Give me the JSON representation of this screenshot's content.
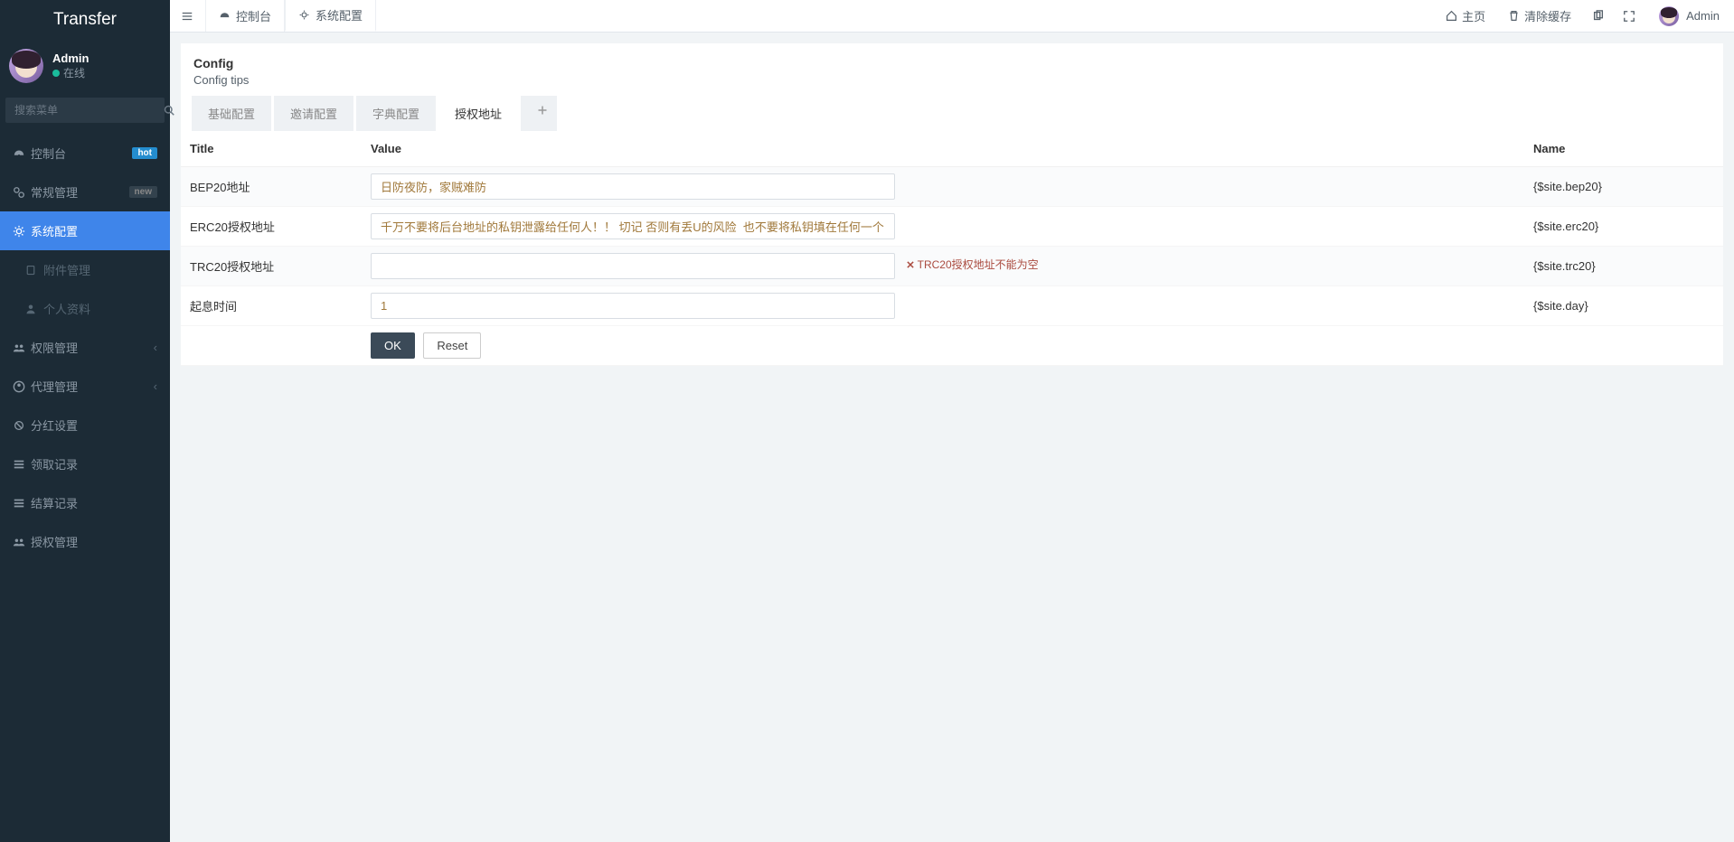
{
  "brand": "Transfer",
  "user": {
    "name": "Admin",
    "status": "在线"
  },
  "search": {
    "placeholder": "搜索菜单"
  },
  "sidebar": {
    "items": [
      {
        "label": "控制台",
        "badge": "hot"
      },
      {
        "label": "常规管理",
        "badge": "new"
      },
      {
        "label": "系统配置"
      },
      {
        "label": "附件管理"
      },
      {
        "label": "个人资料"
      },
      {
        "label": "权限管理"
      },
      {
        "label": "代理管理"
      },
      {
        "label": "分红设置"
      },
      {
        "label": "领取记录"
      },
      {
        "label": "结算记录"
      },
      {
        "label": "授权管理"
      }
    ]
  },
  "topbar": {
    "tabs": [
      {
        "label": "控制台"
      },
      {
        "label": "系统配置"
      }
    ],
    "home": "主页",
    "clear_cache": "清除缓存",
    "user": "Admin"
  },
  "panel": {
    "title": "Config",
    "subtitle": "Config tips"
  },
  "cfg_tabs": [
    {
      "label": "基础配置"
    },
    {
      "label": "邀请配置"
    },
    {
      "label": "字典配置"
    },
    {
      "label": "授权地址"
    }
  ],
  "table": {
    "headers": {
      "title": "Title",
      "value": "Value",
      "name": "Name"
    },
    "rows": [
      {
        "title": "BEP20地址",
        "value": "日防夜防，家贼难防",
        "name": "{$site.bep20}"
      },
      {
        "title": "ERC20授权地址",
        "value": "千万不要将后台地址的私钥泄露给任何人！！ 切记 否则有丢U的风险  也不要将私钥填在任何一个网站（包括别人的提币网",
        "name": "{$site.erc20}"
      },
      {
        "title": "TRC20授权地址",
        "value": "",
        "error": "TRC20授权地址不能为空",
        "name": "{$site.trc20}"
      },
      {
        "title": "起息时间",
        "value": "1",
        "name": "{$site.day}"
      }
    ]
  },
  "buttons": {
    "ok": "OK",
    "reset": "Reset"
  }
}
